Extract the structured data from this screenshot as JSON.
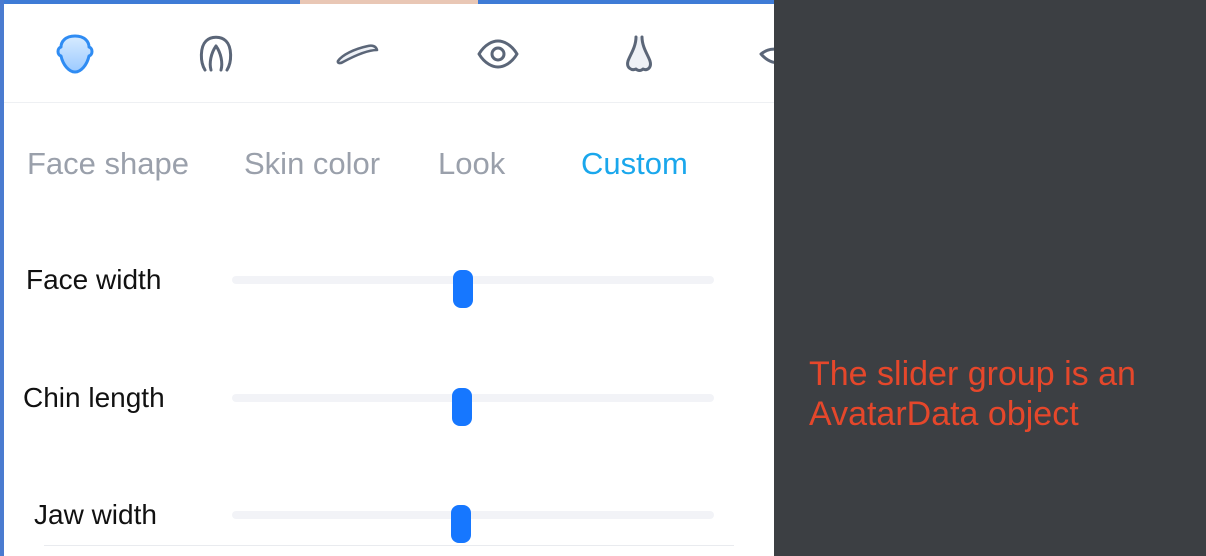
{
  "icons": [
    {
      "name": "face-shape-icon",
      "active": true
    },
    {
      "name": "hair-icon",
      "active": false
    },
    {
      "name": "eyebrow-icon",
      "active": false
    },
    {
      "name": "eye-icon",
      "active": false
    },
    {
      "name": "nose-icon",
      "active": false
    },
    {
      "name": "mouth-icon",
      "active": false
    }
  ],
  "tabs": [
    {
      "label": "Face shape",
      "active": false
    },
    {
      "label": "Skin color",
      "active": false
    },
    {
      "label": "Look",
      "active": false
    },
    {
      "label": "Custom",
      "active": true
    }
  ],
  "sliders": [
    {
      "label": "Face width",
      "value": 0.48
    },
    {
      "label": "Chin length",
      "value": 0.478
    },
    {
      "label": "Jaw width",
      "value": 0.476
    }
  ],
  "annotation": {
    "text": "The slider group is an AvatarData object"
  },
  "colors": {
    "accent": "#1677ff",
    "active_tab": "#1aa7ec",
    "inactive_text": "#9aa0ab",
    "annotation": "#e5472b",
    "background": "#3c3f43"
  }
}
